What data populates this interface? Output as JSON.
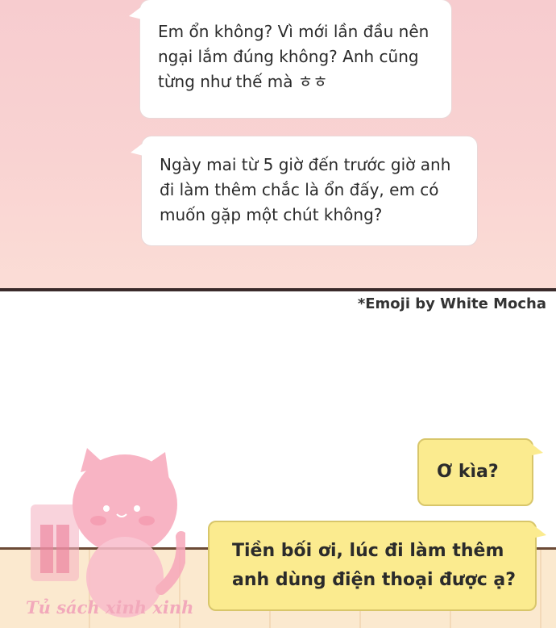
{
  "messages": {
    "top_1": "Em ổn không? Vì mới lần đầu nên ngại lắm đúng không? Anh cũng từng như thế mà ㅎㅎ",
    "top_2": "Ngày mai từ 5 giờ đến trước giờ anh đi làm thêm chắc là ổn đấy, em có muốn gặp một chút không?",
    "reply_1": "Ơ kìa?",
    "reply_2": "Tiền bối ơi, lúc đi làm thêm anh dùng điện thoại được ạ?"
  },
  "credit": "*Emoji by White Mocha",
  "watermark": {
    "text": "Tủ sách xinh xinh",
    "icon": "pink-cat-bookshelf-logo",
    "color": "#f2a9bb"
  },
  "colors": {
    "panel_pink": "#f8cfd0",
    "bubble_yellow": "#fbeb8f",
    "bubble_white": "#ffffff"
  }
}
